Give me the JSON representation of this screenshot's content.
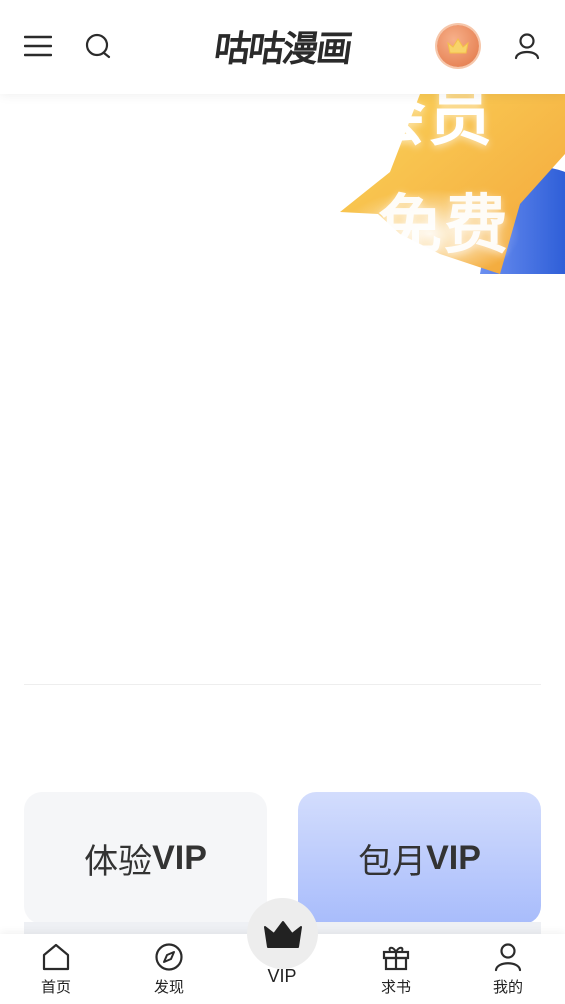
{
  "header": {
    "logo_text": "咕咕漫画"
  },
  "banner": {
    "top_text": "会员",
    "bottom_text": "免费"
  },
  "plans": [
    {
      "prefix": "体验",
      "suffix": "VIP"
    },
    {
      "prefix": "包月",
      "suffix": "VIP"
    }
  ],
  "bottom_nav": {
    "home": "首页",
    "discover": "发现",
    "vip": "VIP",
    "request": "求书",
    "mine": "我的"
  },
  "colors": {
    "accent_orange": "#e8875a",
    "banner_yellow": "#f6b93b",
    "banner_blue": "#2f5fd8",
    "plan_blue": "#a8bcfb"
  }
}
